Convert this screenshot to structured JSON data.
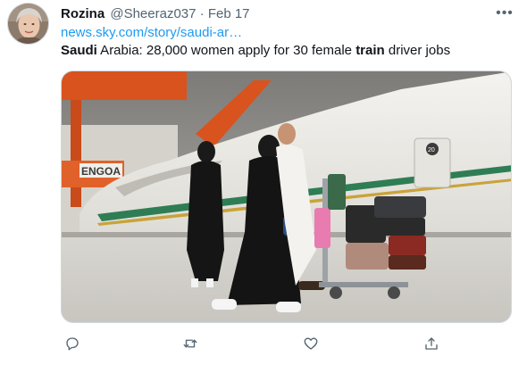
{
  "tweet": {
    "author_name": "Rozina",
    "author_handle": "@Sheeraz037",
    "separator": "·",
    "date": "Feb 17",
    "link_text": "news.sky.com/story/saudi-ar…",
    "text_parts": {
      "b1": "Saudi",
      "t1": " Arabia: 28,000 women apply for 30 female ",
      "b2": "train",
      "t2": " driver jobs"
    },
    "more_glyph": "•••",
    "media_sign_text": "ENGOA",
    "media_car_number": "20"
  },
  "icons": {
    "more": "more-horizontal-icon",
    "reply": "reply-icon",
    "retweet": "retweet-icon",
    "like": "heart-icon",
    "share": "share-icon"
  },
  "colors": {
    "link": "#1d9bf0",
    "secondary_text": "#536471",
    "primary_text": "#0f1419",
    "border": "#cfd9de"
  }
}
